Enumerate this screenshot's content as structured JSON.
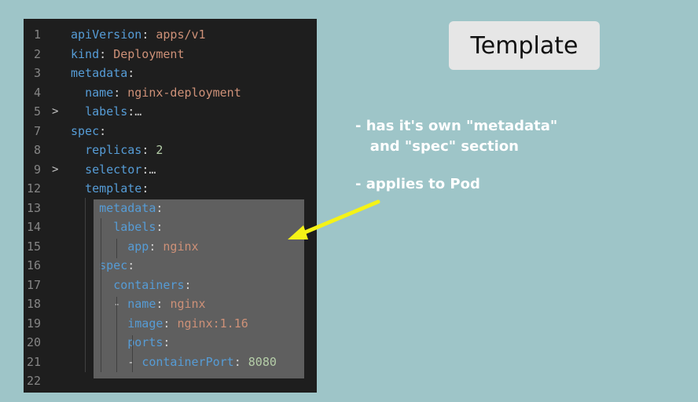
{
  "editor": {
    "lines": [
      {
        "num": "1",
        "fold": "",
        "parts": [
          {
            "c": "k",
            "t": "apiVersion"
          },
          {
            "c": "p",
            "t": ": "
          },
          {
            "c": "v",
            "t": "apps/v1"
          }
        ]
      },
      {
        "num": "2",
        "fold": "",
        "parts": [
          {
            "c": "k",
            "t": "kind"
          },
          {
            "c": "p",
            "t": ": "
          },
          {
            "c": "v",
            "t": "Deployment"
          }
        ]
      },
      {
        "num": "3",
        "fold": "",
        "parts": [
          {
            "c": "k",
            "t": "metadata"
          },
          {
            "c": "p",
            "t": ":"
          }
        ]
      },
      {
        "num": "4",
        "fold": "",
        "parts": [
          {
            "c": "p",
            "t": "  "
          },
          {
            "c": "k",
            "t": "name"
          },
          {
            "c": "p",
            "t": ": "
          },
          {
            "c": "v",
            "t": "nginx-deployment"
          }
        ]
      },
      {
        "num": "5",
        "fold": ">",
        "parts": [
          {
            "c": "p",
            "t": "  "
          },
          {
            "c": "k",
            "t": "labels"
          },
          {
            "c": "p",
            "t": ":"
          },
          {
            "c": "e",
            "t": "…"
          }
        ]
      },
      {
        "num": "7",
        "fold": "",
        "parts": [
          {
            "c": "k",
            "t": "spec"
          },
          {
            "c": "p",
            "t": ":"
          }
        ]
      },
      {
        "num": "8",
        "fold": "",
        "parts": [
          {
            "c": "p",
            "t": "  "
          },
          {
            "c": "k",
            "t": "replicas"
          },
          {
            "c": "p",
            "t": ": "
          },
          {
            "c": "n",
            "t": "2"
          }
        ]
      },
      {
        "num": "9",
        "fold": ">",
        "parts": [
          {
            "c": "p",
            "t": "  "
          },
          {
            "c": "k",
            "t": "selector"
          },
          {
            "c": "p",
            "t": ":"
          },
          {
            "c": "e",
            "t": "…"
          }
        ]
      },
      {
        "num": "12",
        "fold": "",
        "parts": [
          {
            "c": "p",
            "t": "  "
          },
          {
            "c": "k",
            "t": "template"
          },
          {
            "c": "p",
            "t": ":"
          }
        ]
      },
      {
        "num": "13",
        "fold": "",
        "parts": [
          {
            "c": "p",
            "t": "    "
          },
          {
            "c": "k",
            "t": "metadata"
          },
          {
            "c": "p",
            "t": ":"
          }
        ]
      },
      {
        "num": "14",
        "fold": "",
        "parts": [
          {
            "c": "p",
            "t": "      "
          },
          {
            "c": "k",
            "t": "labels"
          },
          {
            "c": "p",
            "t": ":"
          }
        ]
      },
      {
        "num": "15",
        "fold": "",
        "parts": [
          {
            "c": "p",
            "t": "        "
          },
          {
            "c": "k",
            "t": "app"
          },
          {
            "c": "p",
            "t": ": "
          },
          {
            "c": "v",
            "t": "nginx"
          }
        ]
      },
      {
        "num": "16",
        "fold": "",
        "parts": [
          {
            "c": "p",
            "t": "    "
          },
          {
            "c": "k",
            "t": "spec"
          },
          {
            "c": "p",
            "t": ":"
          }
        ]
      },
      {
        "num": "17",
        "fold": "",
        "parts": [
          {
            "c": "p",
            "t": "      "
          },
          {
            "c": "k",
            "t": "containers"
          },
          {
            "c": "p",
            "t": ":"
          }
        ]
      },
      {
        "num": "18",
        "fold": "",
        "parts": [
          {
            "c": "p",
            "t": "      - "
          },
          {
            "c": "k",
            "t": "name"
          },
          {
            "c": "p",
            "t": ": "
          },
          {
            "c": "v",
            "t": "nginx"
          }
        ]
      },
      {
        "num": "19",
        "fold": "",
        "parts": [
          {
            "c": "p",
            "t": "        "
          },
          {
            "c": "k",
            "t": "image"
          },
          {
            "c": "p",
            "t": ": "
          },
          {
            "c": "v",
            "t": "nginx:1.16"
          }
        ]
      },
      {
        "num": "20",
        "fold": "",
        "parts": [
          {
            "c": "p",
            "t": "        "
          },
          {
            "c": "k",
            "t": "ports"
          },
          {
            "c": "p",
            "t": ":"
          }
        ]
      },
      {
        "num": "21",
        "fold": "",
        "parts": [
          {
            "c": "p",
            "t": "        - "
          },
          {
            "c": "k",
            "t": "containerPort"
          },
          {
            "c": "p",
            "t": ": "
          },
          {
            "c": "n",
            "t": "8080"
          }
        ]
      },
      {
        "num": "22",
        "fold": "",
        "parts": []
      }
    ]
  },
  "slide": {
    "title": "Template",
    "bullet1": "- has it's own \"metadata\"\n   and \"spec\" section",
    "bullet2": "- applies to Pod"
  },
  "colors": {
    "background": "#9ec5c8",
    "arrow": "#f5f316",
    "editor_bg": "#1e1e1e",
    "highlight": "#5f5f5f"
  }
}
